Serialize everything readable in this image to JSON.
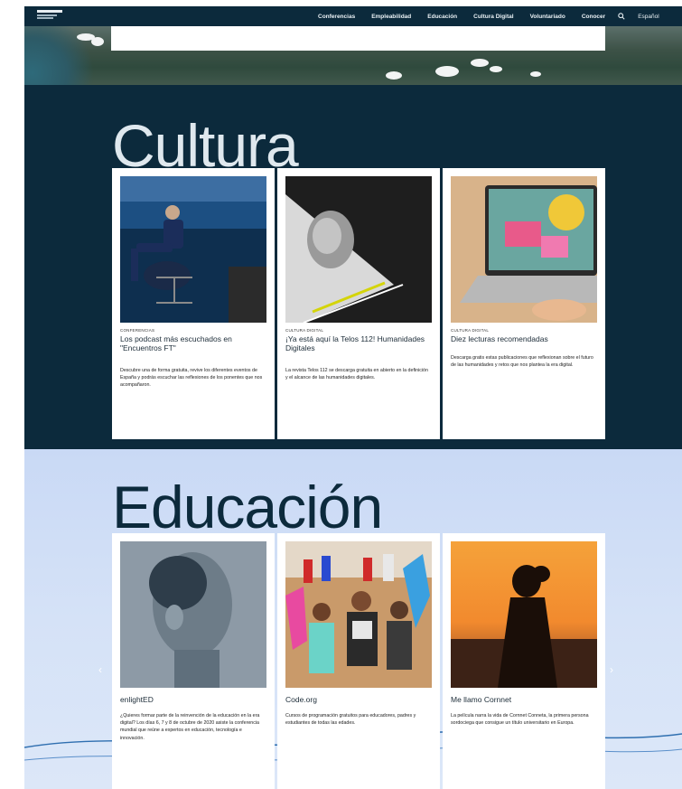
{
  "nav": {
    "items": [
      "Conferencias",
      "Empleabilidad",
      "Educación",
      "Cultura Digital",
      "Voluntariado",
      "Conocer"
    ],
    "search_icon": "search-icon",
    "language": "Español"
  },
  "sections": {
    "cultura": {
      "title": "Cultura",
      "cards": [
        {
          "category": "CONFERENCIAS",
          "title": "Los podcast más escuchados en \"Encuentros FT\"",
          "description": "Descubre una de forma gratuita, revive los diferentes eventos de España y podrás escuchar las reflexiones de los ponentes que nos acompañaron."
        },
        {
          "category": "CULTURA DIGITAL",
          "title": "¡Ya está aquí la Telos 112! Humanidades Digitales",
          "description": "La revista Telos 112 se descarga gratuita en abierto en la definición y el alcance de las humanidades digitales."
        },
        {
          "category": "CULTURA DIGITAL",
          "title": "Diez lecturas recomendadas",
          "description": "Descarga gratis estas publicaciones que reflexionan sobre el futuro de las humanidades y retos que nos plantea la era digital."
        }
      ]
    },
    "educacion": {
      "title": "Educación",
      "cards": [
        {
          "title": "enlightED",
          "description": "¿Quieres formar parte de la reinvención de la educación en la era digital? Los días 6, 7 y 8 de octubre de 2020 asiste la conferencia mundial que reúne a expertos en educación, tecnología e innovación."
        },
        {
          "title": "Code.org",
          "description": "Cursos de programación gratuitos para educadores, padres y estudiantes de todas las edades."
        },
        {
          "title": "Me llamo Cornnet",
          "description": "La película narra la vida de Cornnet Conneta, la primera persona sordociega que consigue un título universitario en Europa."
        }
      ]
    }
  },
  "colors": {
    "navy": "#0c2a3c",
    "edu_bg": "#d5e2f7",
    "card": "#ffffff"
  }
}
